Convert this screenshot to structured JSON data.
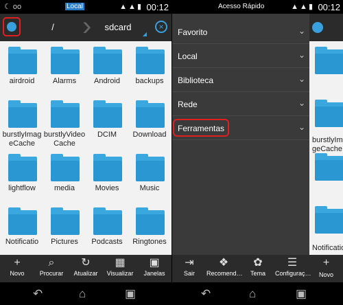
{
  "status_left": {
    "time": "00:12",
    "center_tag": "Local",
    "left_icons": "☾ oo"
  },
  "status_right": {
    "time": "00:12",
    "title": "Acesso Rápido"
  },
  "toolbar": {
    "path_root": "/",
    "path_current": "sdcard"
  },
  "folders": [
    {
      "label": "airdroid"
    },
    {
      "label": "Alarms"
    },
    {
      "label": "Android"
    },
    {
      "label": "backups"
    },
    {
      "label": "burstlyImageCache"
    },
    {
      "label": "burstlyVideoCache"
    },
    {
      "label": "DCIM"
    },
    {
      "label": "Download"
    },
    {
      "label": "lightflow"
    },
    {
      "label": "media"
    },
    {
      "label": "Movies"
    },
    {
      "label": "Music"
    },
    {
      "label": "Notificatio"
    },
    {
      "label": "Pictures"
    },
    {
      "label": "Podcasts"
    },
    {
      "label": "Ringtones"
    }
  ],
  "bottom_left": [
    {
      "label": "Novo",
      "icon": "+"
    },
    {
      "label": "Procurar",
      "icon": "⌕"
    },
    {
      "label": "Atualizar",
      "icon": "↻"
    },
    {
      "label": "Visualizar",
      "icon": "▦"
    },
    {
      "label": "Janelas",
      "icon": "▣"
    }
  ],
  "drawer": [
    {
      "label": "Favorito"
    },
    {
      "label": "Local"
    },
    {
      "label": "Biblioteca"
    },
    {
      "label": "Rede"
    },
    {
      "label": "Ferramentas"
    }
  ],
  "bottom_right": [
    {
      "label": "Sair",
      "icon": "⇥"
    },
    {
      "label": "Recomend…",
      "icon": "❖"
    },
    {
      "label": "Tema",
      "icon": "✿"
    },
    {
      "label": "Configuraç…",
      "icon": "☰"
    }
  ],
  "peek": {
    "labels": [
      "burstlyIma",
      "geCache",
      "Notificatio"
    ],
    "bottom_label": "Novo"
  },
  "colors": {
    "accent": "#3aa0dd",
    "highlight": "#e02020",
    "folder": "#3ba7df"
  }
}
